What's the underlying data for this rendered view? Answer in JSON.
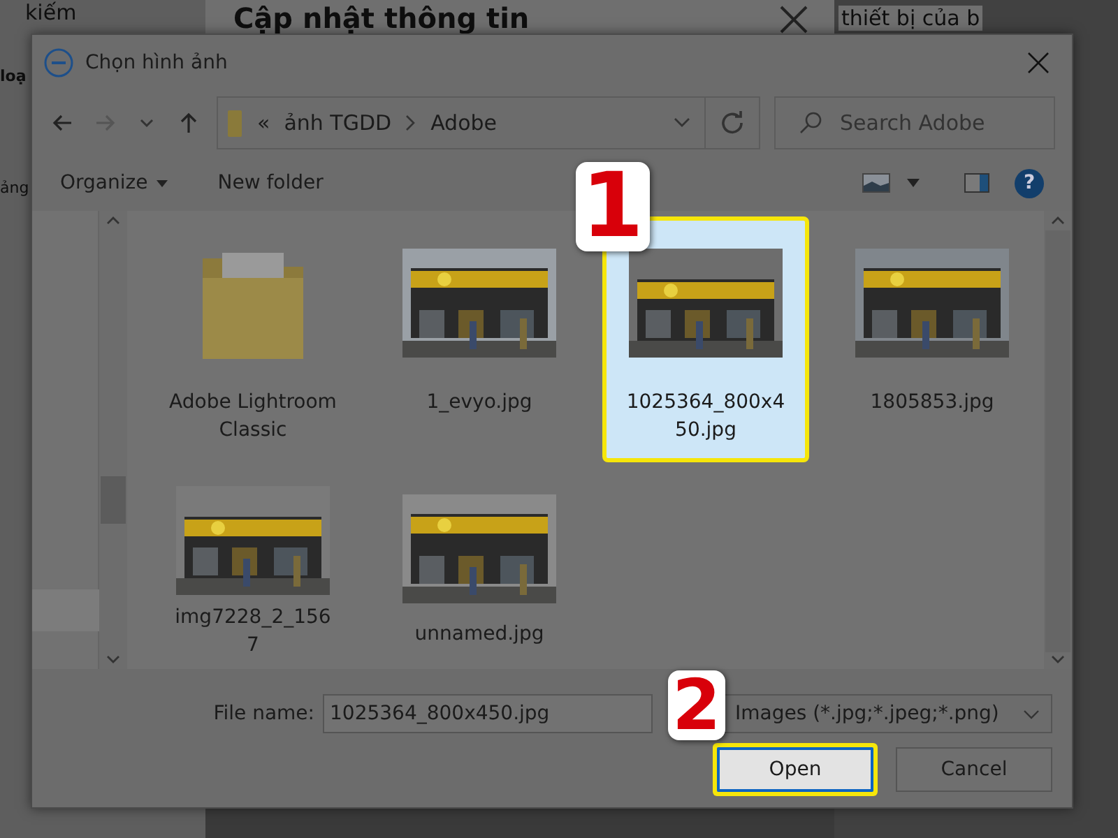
{
  "background_page": {
    "left_texts": [
      "kiếm",
      "loạ",
      "ảng"
    ],
    "modal_title": "Cập nhật thông tin",
    "right_text": "thiết bị của b"
  },
  "dialog": {
    "title": "Chọn hình ảnh",
    "address": {
      "prefix": "«",
      "segments": [
        "ảnh TGDD",
        "Adobe"
      ]
    },
    "search": {
      "placeholder": "Search Adobe"
    },
    "toolbar": {
      "organize": "Organize",
      "new_folder": "New folder",
      "help": "?"
    },
    "files": [
      {
        "name": "Adobe Lightroom Classic",
        "kind": "folder",
        "selected": false
      },
      {
        "name": "1_evyo.jpg",
        "kind": "picture",
        "selected": false
      },
      {
        "name": "1025364_800x450.jpg",
        "kind": "picture",
        "selected": true
      },
      {
        "name": "1805853.jpg",
        "kind": "picture",
        "selected": false
      },
      {
        "name": "img7228_2_1567",
        "kind": "picture",
        "selected": false
      },
      {
        "name": "unnamed.jpg",
        "kind": "picture",
        "selected": false
      }
    ],
    "file_name": {
      "label": "File name:",
      "value": "1025364_800x450.jpg"
    },
    "file_type": "Images (*.jpg;*.jpeg;*.png)",
    "buttons": [
      {
        "label": "Open",
        "default": true
      },
      {
        "label": "Cancel",
        "default": false
      }
    ]
  },
  "annotations": [
    "1",
    "2"
  ]
}
